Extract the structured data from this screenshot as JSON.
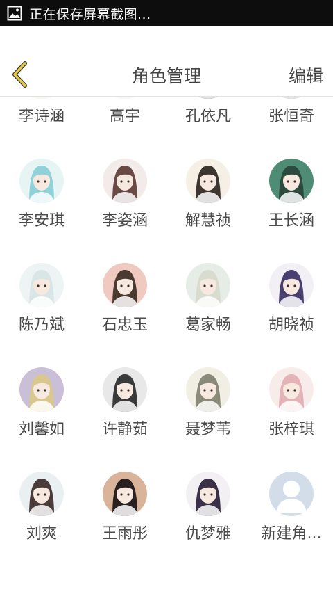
{
  "status_bar": {
    "text": "正在保存屏幕截图..."
  },
  "header": {
    "title": "角色管理",
    "edit_label": "编辑"
  },
  "roles": [
    {
      "name": "李诗涵",
      "avatar_bg": "#e8e4d8",
      "hair": "#cfc6a8"
    },
    {
      "name": "高宇",
      "avatar_bg": "#eef2f6",
      "hair": "#c9d3e3"
    },
    {
      "name": "孔依凡",
      "avatar_bg": "#f3efe8",
      "hair": "#3a2a22"
    },
    {
      "name": "张恒奇",
      "avatar_bg": "#eee8e0",
      "hair": "#6b5645"
    },
    {
      "name": "李安琪",
      "avatar_bg": "#e6f4f4",
      "hair": "#8fd2da"
    },
    {
      "name": "李姿涵",
      "avatar_bg": "#f3eaea",
      "hair": "#6a4a45"
    },
    {
      "name": "解慧祯",
      "avatar_bg": "#f6efe6",
      "hair": "#3d3530"
    },
    {
      "name": "王长涵",
      "avatar_bg": "#4f8c76",
      "hair": "#2d4a3e"
    },
    {
      "name": "陈乃斌",
      "avatar_bg": "#eef3f3",
      "hair": "#d9e6e6"
    },
    {
      "name": "石忠玉",
      "avatar_bg": "#f0c9c0",
      "hair": "#4a3a30"
    },
    {
      "name": "葛家畅",
      "avatar_bg": "#e6ece6",
      "hair": "#d8dccf"
    },
    {
      "name": "胡晓祯",
      "avatar_bg": "#f2f0f4",
      "hair": "#4a4070"
    },
    {
      "name": "刘馨如",
      "avatar_bg": "#c9c0d8",
      "hair": "#d8c78f"
    },
    {
      "name": "许静茹",
      "avatar_bg": "#e8e8e8",
      "hair": "#3a3a3a"
    },
    {
      "name": "聂梦苇",
      "avatar_bg": "#f1efe4",
      "hair": "#8a8a7a"
    },
    {
      "name": "张梓琪",
      "avatar_bg": "#f8eceb",
      "hair": "#e3b3b8"
    },
    {
      "name": "刘爽",
      "avatar_bg": "#eaeff2",
      "hair": "#4a3c3a"
    },
    {
      "name": "王雨彤",
      "avatar_bg": "#d9b49a",
      "hair": "#2b2020"
    },
    {
      "name": "仇梦雅",
      "avatar_bg": "#f2f0f2",
      "hair": "#3a3148"
    },
    {
      "name": "新建角...",
      "avatar_bg": "#d3dde9",
      "hair": "#ffffff",
      "placeholder": true
    }
  ],
  "colors": {
    "back_arrow": "#e4c84a",
    "title": "#444444",
    "status_bg": "#0d0d0d"
  }
}
